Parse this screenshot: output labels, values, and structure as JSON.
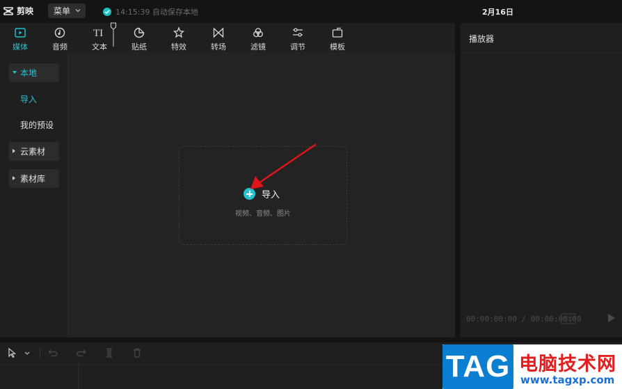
{
  "app": {
    "name": "剪映",
    "menu_label": "菜单",
    "autosave_text": "14:15:39 自动保存本地",
    "date": "2月16日"
  },
  "toolbar": {
    "tabs": [
      {
        "label": "媒体",
        "icon": "media-icon",
        "active": true
      },
      {
        "label": "音频",
        "icon": "audio-icon"
      },
      {
        "label": "文本",
        "icon": "text-icon"
      },
      {
        "label": "贴纸",
        "icon": "sticker-icon"
      },
      {
        "label": "特效",
        "icon": "effects-icon"
      },
      {
        "label": "转场",
        "icon": "transition-icon"
      },
      {
        "label": "滤镜",
        "icon": "filter-icon"
      },
      {
        "label": "调节",
        "icon": "adjust-icon"
      },
      {
        "label": "模板",
        "icon": "template-icon"
      }
    ]
  },
  "sidebar": {
    "items": [
      {
        "label": "本地",
        "expanded": true,
        "active": true
      },
      {
        "label": "导入",
        "active": true
      },
      {
        "label": "我的预设"
      },
      {
        "label": "云素材",
        "expanded": false
      },
      {
        "label": "素材库",
        "expanded": false
      }
    ]
  },
  "dropzone": {
    "import_label": "导入",
    "hint": "视频、音频、图片"
  },
  "player": {
    "title": "播放器",
    "timecode": "00:00:00:00 / 00:00:00:00"
  },
  "watermark": {
    "tag": "TAG",
    "title": "电脑技术网",
    "url": "www.tagxp.com"
  },
  "colors": {
    "accent": "#22c4d4",
    "background": "#141414",
    "panel": "#1f1f1f",
    "arrow": "#e0151b"
  }
}
